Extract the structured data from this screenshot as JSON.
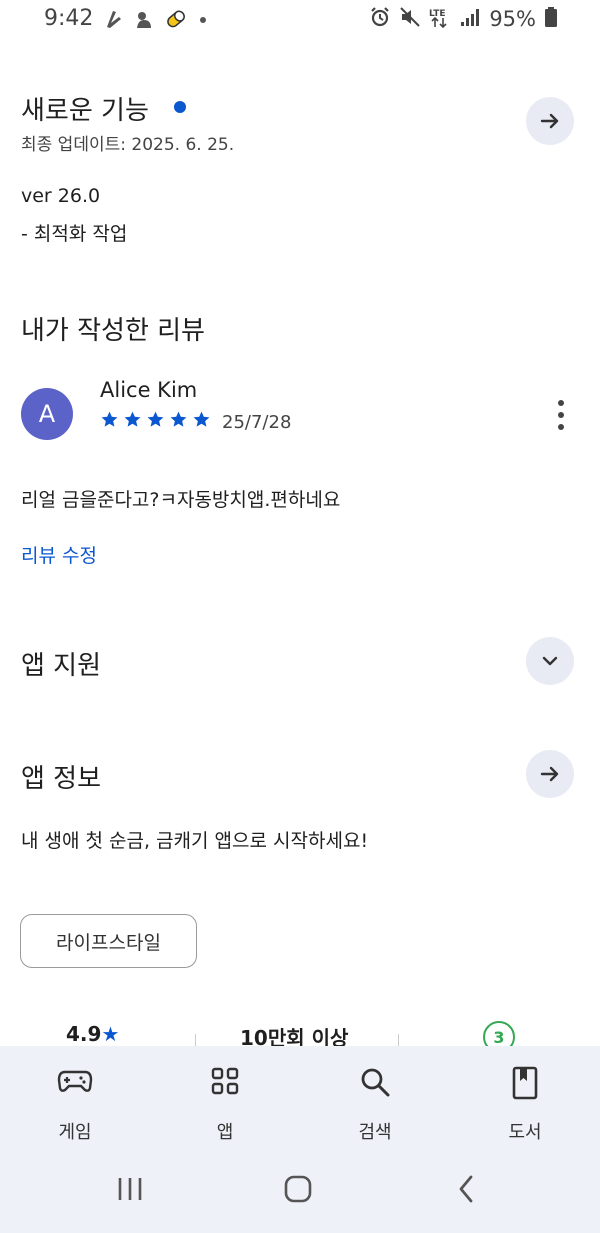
{
  "status_bar": {
    "time": "9:42",
    "battery": "95%",
    "icons": [
      "gesture-icon",
      "cat-icon",
      "pill-icon",
      "dot-icon",
      "alarm-icon",
      "mute-icon",
      "lte-icon",
      "signal-icon",
      "battery-icon"
    ]
  },
  "whats_new": {
    "title": "새로운 기능",
    "updated": "최종 업데이트: 2025. 6. 25.",
    "version": "ver 26.0",
    "note": "- 최적화 작업"
  },
  "my_review": {
    "heading": "내가 작성한 리뷰",
    "avatar_letter": "A",
    "reviewer": "Alice Kim",
    "rating": 5,
    "date": "25/7/28",
    "text": "리얼 금을준다고?ㅋ자동방치앱.편하네요",
    "edit_link": "리뷰 수정"
  },
  "app_support": {
    "title": "앱 지원"
  },
  "app_info": {
    "title": "앱 정보",
    "description": "내 생애 첫 순금, 금캐기 앱으로 시작하세요!",
    "category": "라이프스타일"
  },
  "stats": {
    "rating": "4.9",
    "rating_star": "★",
    "downloads": "10만회 이상",
    "age_rating": "3"
  },
  "bottom_nav": {
    "items": [
      {
        "label": "게임",
        "icon": "gamepad-icon"
      },
      {
        "label": "앱",
        "icon": "apps-grid-icon"
      },
      {
        "label": "검색",
        "icon": "search-icon"
      },
      {
        "label": "도서",
        "icon": "book-icon"
      }
    ]
  },
  "colors": {
    "accent": "#0b57d0",
    "avatar": "#5b62c8",
    "button_bg": "#e8ebf4",
    "nav_bg": "#eef1f8",
    "age_badge": "#34a853"
  }
}
